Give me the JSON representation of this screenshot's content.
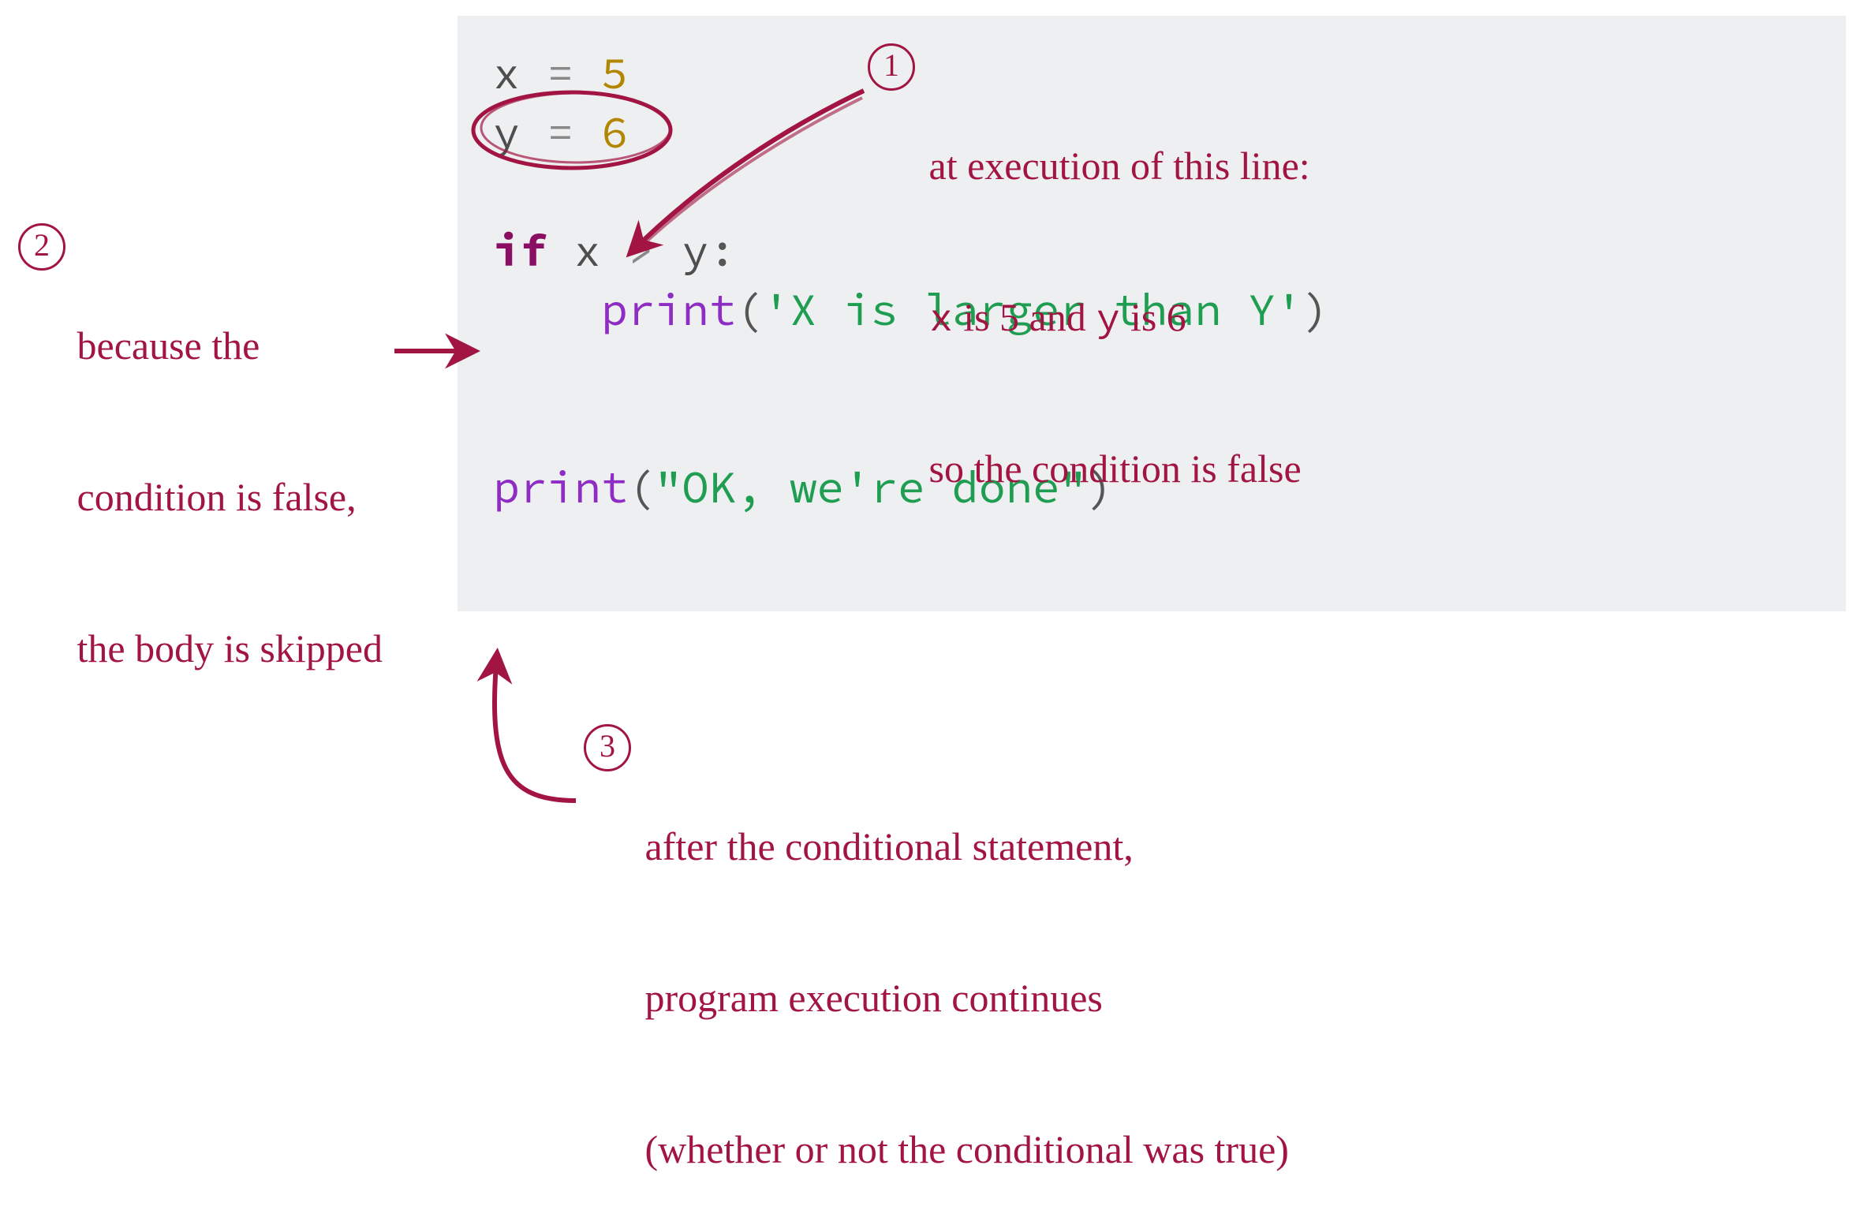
{
  "code": {
    "x_var": "x",
    "x_eq": " = ",
    "x_val": "5",
    "y_var": "y",
    "y_eq": " = ",
    "y_val": "6",
    "if_kw": "if",
    "if_sp": " ",
    "if_l": "x",
    "if_op": " > ",
    "if_r": "y",
    "if_colon": ":",
    "indent": "    ",
    "print1_fn": "print",
    "print1_lp": "(",
    "print1_str": "'X is larger than Y'",
    "print1_rp": ")",
    "print2_fn": "print",
    "print2_lp": "(",
    "print2_str": "\"OK, we're done\"",
    "print2_rp": ")"
  },
  "annotations": {
    "n1": {
      "badge": "1",
      "line1_pre": " at execution of this line:",
      "line2_x": "x",
      "line2_mid": " is 5 and ",
      "line2_y": "y",
      "line2_post": " is 6",
      "line3": " so the condition is false"
    },
    "n2": {
      "badge": "2",
      "line1": " because the",
      "line2": " condition is false,",
      "line3": " the body is skipped"
    },
    "n3": {
      "badge": "3",
      "line1": " after the conditional statement,",
      "line2": " program execution continues",
      "line3": " (whether or not the conditional was true)"
    }
  },
  "colors": {
    "annotation": "#a21543",
    "code_bg": "#edeff1",
    "keyword": "#8a0f63",
    "number": "#b38600",
    "function": "#8e2cc4",
    "string": "#1f9e52",
    "variable": "#4e4e4e",
    "operator": "#888888"
  }
}
